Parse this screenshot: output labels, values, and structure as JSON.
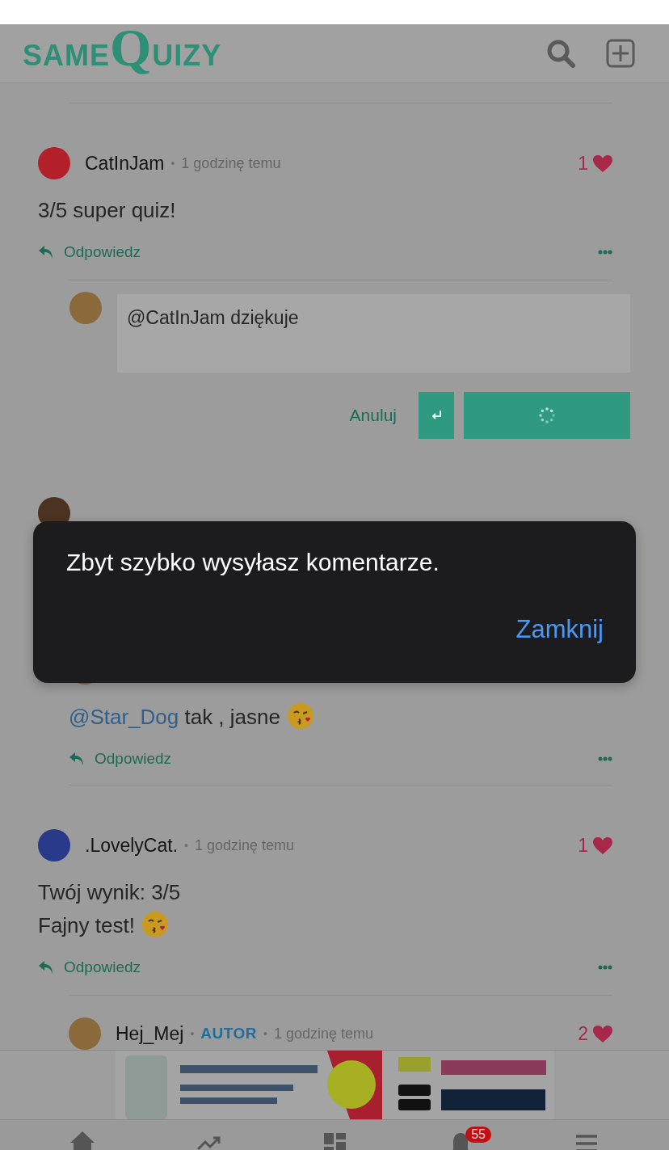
{
  "header": {
    "logo": [
      "SAME",
      "Q",
      "UIZY"
    ]
  },
  "comments": [
    {
      "nested": false,
      "author": "CatInJam",
      "color": "#b3202a",
      "separator": "•",
      "time": "1 godzinę temu",
      "likes": "1",
      "body": [
        [
          {
            "kind": "text",
            "text": "3/5 super quiz!"
          }
        ]
      ],
      "reply_label": "Odpowiedz",
      "reply_form": {
        "value": "@CatInJam dziękuje",
        "cancel": "Anuluj",
        "loading": true
      }
    },
    {
      "nested": false,
      "color": "#4a3320"
    },
    {
      "nested": true,
      "body": [
        [
          {
            "kind": "mention",
            "text": "@Star_Dog"
          },
          {
            "kind": "text",
            "text": "tak , jasne"
          },
          {
            "kind": "emoji"
          }
        ]
      ],
      "reply_label": "Odpowiedz"
    },
    {
      "nested": false,
      "author": ".LovelyCat.",
      "color": "#2a3a8a",
      "separator": "•",
      "time": "1 godzinę temu",
      "likes": "1",
      "body": [
        [
          {
            "kind": "text",
            "text": "Twój wynik: 3/5"
          }
        ],
        [
          {
            "kind": "text",
            "text": "Fajny test!"
          },
          {
            "kind": "emoji"
          }
        ]
      ],
      "reply_label": "Odpowiedz"
    },
    {
      "nested": true,
      "author": "Hej_Mej",
      "badge": "AUTOR",
      "color": "#8a6a3a",
      "separator": "•",
      "time": "1 godzinę temu",
      "likes": "2"
    }
  ],
  "nav": [
    {
      "kind": "home"
    },
    {
      "kind": "trending"
    },
    {
      "kind": "dashboard"
    },
    {
      "kind": "notifications",
      "badge": "55"
    },
    {
      "kind": "menu"
    }
  ],
  "dialog": {
    "message": "Zbyt szybko wysyłasz komentarze.",
    "button": "Zamknij"
  }
}
